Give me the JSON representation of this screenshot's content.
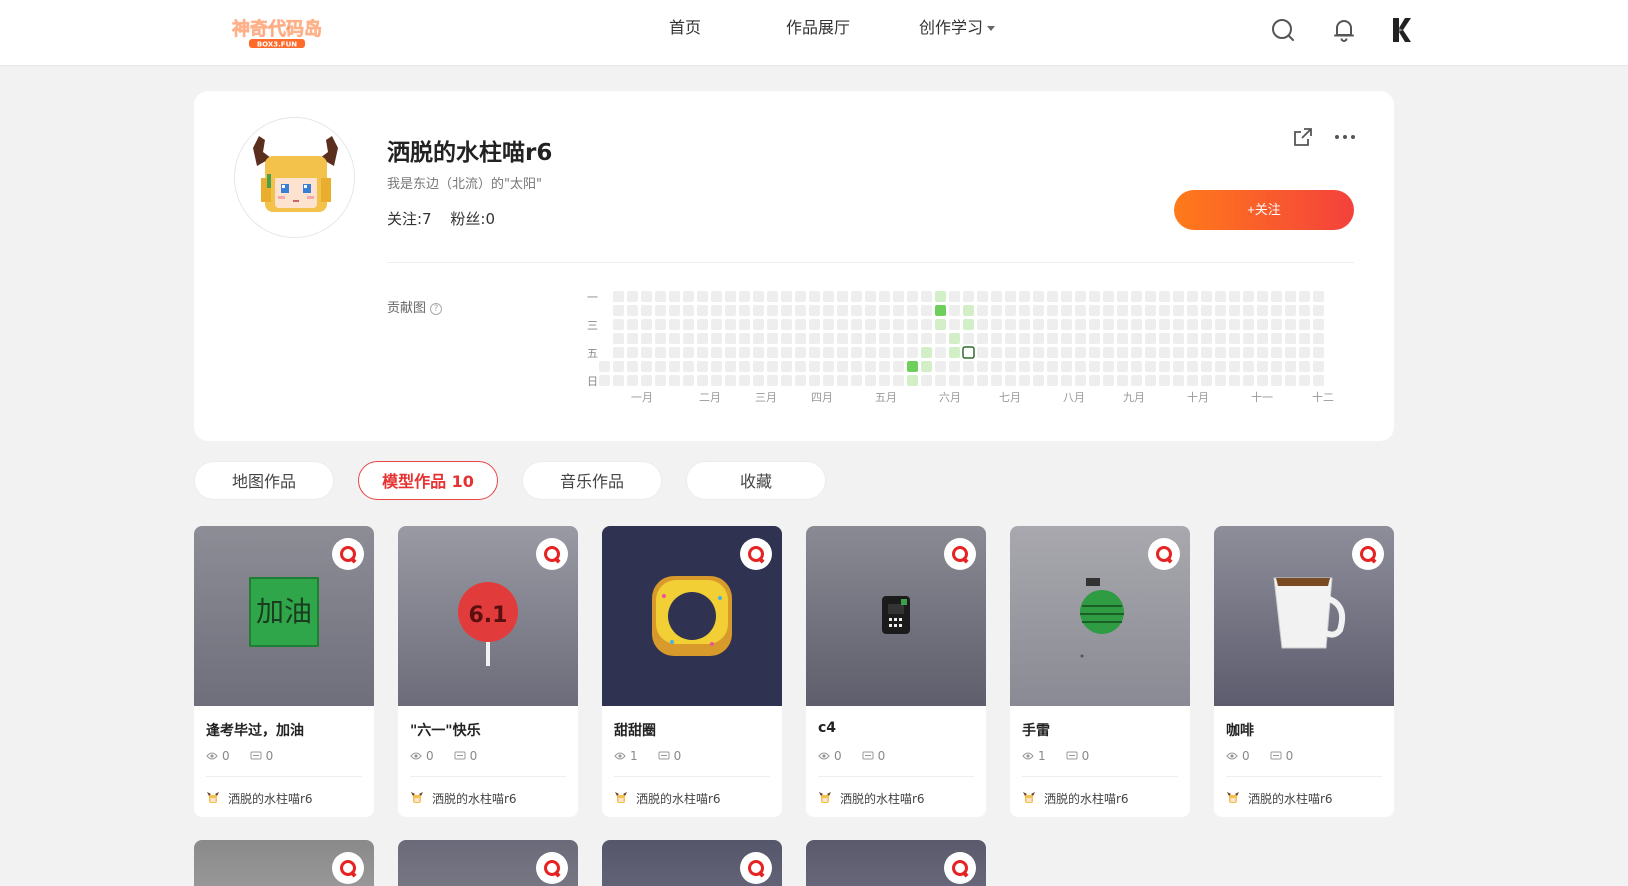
{
  "nav": {
    "logo_text": "神奇代码岛",
    "logo_sub": "BOX3.FUN",
    "links": [
      {
        "label": "首页"
      },
      {
        "label": "作品展厅"
      },
      {
        "label": "创作学习"
      }
    ]
  },
  "profile": {
    "name": "洒脱的水柱喵r6",
    "bio": "我是东边（北流）的\"太阳\"",
    "following": "关注:7",
    "followers": "粉丝:0",
    "follow_button": "+关注"
  },
  "contribution": {
    "label": "贡献图",
    "help_glyph": "?",
    "weekdays": [
      "一",
      "三",
      "五",
      "日"
    ],
    "months": [
      "一月",
      "二月",
      "三月",
      "四月",
      "五月",
      "六月",
      "七月",
      "八月",
      "九月",
      "十月",
      "十一",
      "十二"
    ],
    "active_cells": [
      {
        "week": 22,
        "day": 5,
        "level": 3
      },
      {
        "week": 22,
        "day": 6,
        "level": 1
      },
      {
        "week": 23,
        "day": 4,
        "level": 1
      },
      {
        "week": 23,
        "day": 5,
        "level": 1
      },
      {
        "week": 24,
        "day": 1,
        "level": 3
      },
      {
        "week": 24,
        "day": 2,
        "level": 1
      },
      {
        "week": 24,
        "day": 0,
        "level": 1
      },
      {
        "week": 25,
        "day": 3,
        "level": 1
      },
      {
        "week": 25,
        "day": 4,
        "level": 1
      },
      {
        "week": 26,
        "day": 1,
        "level": 1
      },
      {
        "week": 26,
        "day": 2,
        "level": 1
      },
      {
        "week": 26,
        "day": 4,
        "level": 0,
        "selected": true
      }
    ]
  },
  "tabs": [
    {
      "label": "地图作品",
      "active": false
    },
    {
      "label": "模型作品 10",
      "active": true
    },
    {
      "label": "音乐作品",
      "active": false
    },
    {
      "label": "收藏",
      "active": false
    }
  ],
  "cards": [
    {
      "title": "逢考毕过，加油",
      "views": "0",
      "comments": "0",
      "author": "洒脱的水柱喵r6",
      "thumb": "green-sign",
      "thumb_text": "加油"
    },
    {
      "title": "\"六一\"快乐",
      "views": "0",
      "comments": "0",
      "author": "洒脱的水柱喵r6",
      "thumb": "lollipop",
      "thumb_text": "6.1"
    },
    {
      "title": "甜甜圈",
      "views": "1",
      "comments": "0",
      "author": "洒脱的水柱喵r6",
      "thumb": "donut"
    },
    {
      "title": "c4",
      "views": "0",
      "comments": "0",
      "author": "洒脱的水柱喵r6",
      "thumb": "c4"
    },
    {
      "title": "手雷",
      "views": "1",
      "comments": "0",
      "author": "洒脱的水柱喵r6",
      "thumb": "grenade"
    },
    {
      "title": "咖啡",
      "views": "0",
      "comments": "0",
      "author": "洒脱的水柱喵r6",
      "thumb": "coffee"
    }
  ],
  "colors": {
    "accent": "#e63232",
    "follow_gradient_start": "#ff7a1a",
    "follow_gradient_end": "#f4413c",
    "contrib_empty": "#eeeeee",
    "contrib_light": "#d3efc8",
    "contrib_mid": "#9bd88a",
    "contrib_dark": "#6fcf5b"
  }
}
